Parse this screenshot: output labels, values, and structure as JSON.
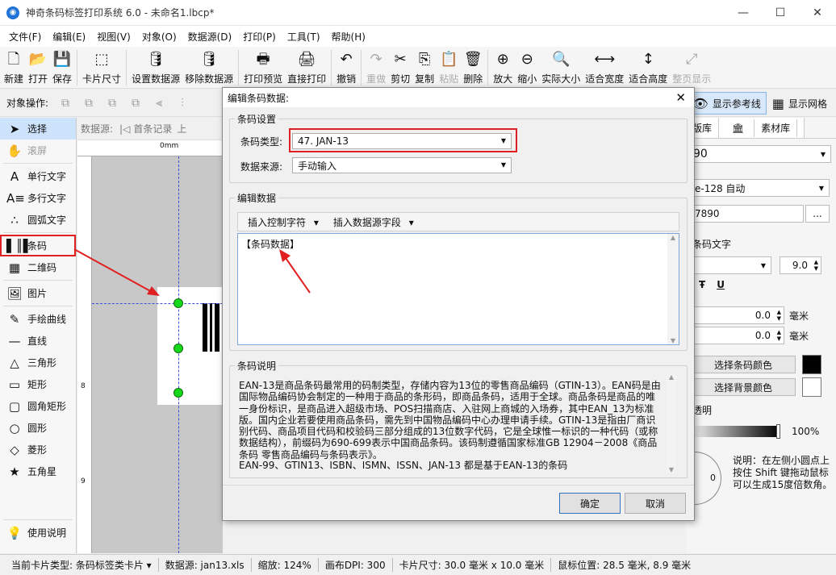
{
  "window": {
    "title": "神奇条码标签打印系统 6.0 - 未命名1.lbcp*",
    "min_icon": "minimize-icon",
    "max_icon": "maximize-icon",
    "close_icon": "close-icon"
  },
  "menu": [
    "文件(F)",
    "编辑(E)",
    "视图(V)",
    "对象(O)",
    "数据源(D)",
    "打印(P)",
    "工具(T)",
    "帮助(H)"
  ],
  "toolbar": [
    {
      "label": "新建",
      "icon": "new-file-icon",
      "glyph": "🗋"
    },
    {
      "label": "打开",
      "icon": "open-file-icon",
      "glyph": "📂"
    },
    {
      "label": "保存",
      "icon": "save-icon",
      "glyph": "💾"
    },
    {
      "label": "卡片尺寸",
      "icon": "card-size-icon",
      "glyph": "⬚"
    },
    {
      "label": "设置数据源",
      "icon": "set-datasource-icon",
      "glyph": "🛢"
    },
    {
      "label": "移除数据源",
      "icon": "remove-datasource-icon",
      "glyph": "🛢"
    },
    {
      "label": "打印预览",
      "icon": "print-preview-icon",
      "glyph": "🖶"
    },
    {
      "label": "直接打印",
      "icon": "print-icon",
      "glyph": "🖨"
    },
    {
      "label": "撤销",
      "icon": "undo-icon",
      "glyph": "↶"
    },
    {
      "label": "重做",
      "icon": "redo-icon",
      "glyph": "↷",
      "disabled": true
    },
    {
      "label": "剪切",
      "icon": "cut-icon",
      "glyph": "✂"
    },
    {
      "label": "复制",
      "icon": "copy-icon",
      "glyph": "⎘"
    },
    {
      "label": "粘贴",
      "icon": "paste-icon",
      "glyph": "📋",
      "disabled": true
    },
    {
      "label": "删除",
      "icon": "delete-icon",
      "glyph": "🗑"
    },
    {
      "label": "放大",
      "icon": "zoom-in-icon",
      "glyph": "⊕"
    },
    {
      "label": "缩小",
      "icon": "zoom-out-icon",
      "glyph": "⊖"
    },
    {
      "label": "实际大小",
      "icon": "actual-size-icon",
      "glyph": "🔍"
    },
    {
      "label": "适合宽度",
      "icon": "fit-width-icon",
      "glyph": "⟷"
    },
    {
      "label": "适合高度",
      "icon": "fit-height-icon",
      "glyph": "↕"
    },
    {
      "label": "整页显示",
      "icon": "full-page-icon",
      "glyph": "⤢",
      "disabled": true
    }
  ],
  "objbar": {
    "label": "对象操作:",
    "show_guides": "显示参考线",
    "show_grid": "显示网格"
  },
  "left_tools": [
    {
      "label": "选择",
      "icon": "pointer-icon",
      "glyph": "➤",
      "selected": true
    },
    {
      "label": "滚屏",
      "icon": "hand-icon",
      "glyph": "✋",
      "disabled": true
    },
    {
      "label": "单行文字",
      "icon": "single-text-icon",
      "glyph": "A"
    },
    {
      "label": "多行文字",
      "icon": "multi-text-icon",
      "glyph": "A≡"
    },
    {
      "label": "圆弧文字",
      "icon": "arc-text-icon",
      "glyph": "∴"
    },
    {
      "label": "条码",
      "icon": "barcode-icon",
      "glyph": "▌║▌"
    },
    {
      "label": "二维码",
      "icon": "qrcode-icon",
      "glyph": "▦"
    },
    {
      "label": "图片",
      "icon": "image-icon",
      "glyph": "🖼"
    },
    {
      "label": "手绘曲线",
      "icon": "pencil-icon",
      "glyph": "✎"
    },
    {
      "label": "直线",
      "icon": "line-icon",
      "glyph": "—"
    },
    {
      "label": "三角形",
      "icon": "triangle-icon",
      "glyph": "△"
    },
    {
      "label": "矩形",
      "icon": "rectangle-icon",
      "glyph": "▭"
    },
    {
      "label": "圆角矩形",
      "icon": "rounded-rect-icon",
      "glyph": "▢"
    },
    {
      "label": "圆形",
      "icon": "circle-icon",
      "glyph": "○"
    },
    {
      "label": "菱形",
      "icon": "diamond-icon",
      "glyph": "◇"
    },
    {
      "label": "五角星",
      "icon": "star-icon",
      "glyph": "★"
    },
    {
      "label": "使用说明",
      "icon": "help-bulb-icon",
      "glyph": "💡"
    }
  ],
  "nav": {
    "label": "数据源:",
    "first": "首条记录",
    "prev": "上"
  },
  "ruler": {
    "top_label": "0mm",
    "left_label_1": "8",
    "left_label_2": "9"
  },
  "right_panel": {
    "tab_1": "版库",
    "tab_2": "素材库",
    "value_1": "90",
    "value_2": "e-128 自动",
    "value_3": "7890",
    "more": "...",
    "section_text": "条码文字",
    "font_size": "9.0",
    "offset_1": "0.0",
    "offset_2": "0.0",
    "unit": "毫米",
    "choose_bar_color": "选择条码颜色",
    "choose_bg_color": "选择背景颜色",
    "transparency": "透明",
    "percent": "100%",
    "rotation_value": "0",
    "hint": "说明：在左侧小圆点上按住 Shift 键拖动鼠标可以生成15度倍数角。"
  },
  "status": {
    "card_type": "当前卡片类型: 条码标签类卡片",
    "datasource": "数据源: jan13.xls",
    "zoom": "缩放: 124%",
    "dpi": "画布DPI: 300",
    "card_size": "卡片尺寸: 30.0 毫米 x 10.0 毫米",
    "mouse_pos": "鼠标位置: 28.5 毫米, 8.9 毫米"
  },
  "dialog": {
    "title": "编辑条码数据:",
    "group_barcode_settings": "条码设置",
    "barcode_type_label": "条码类型:",
    "barcode_type_value": "47. JAN-13",
    "data_source_label": "数据来源:",
    "data_source_value": "手动输入",
    "group_edit_data": "编辑数据",
    "insert_control_char": "插入控制字符",
    "insert_datasource_field": "插入数据源字段",
    "edit_content": "【条码数据】",
    "group_description": "条码说明",
    "description": "EAN-13是商品条码最常用的码制类型，存储内容为13位的零售商品编码（GTIN-13）。EAN码是由国际物品编码协会制定的一种用于商品的条形码，即商品条码，适用于全球。商品条码是商品的唯一身份标识，是商品进入超级市场、POS扫描商店、入驻网上商城的入场券，其中EAN_13为标准版。国内企业若要使用商品条码，需先到中国物品编码中心办理申请手续。GTIN-13是指由厂商识别代码、商品项目代码和校验码三部分组成的13位数字代码，它是全球惟一标识的一种代码（或称数据结构），前缀码为690-699表示中国商品条码。该码制遵循国家标准GB 12904－2008《商品条码 零售商品编码与条码表示》。",
    "description_2": "EAN-99、GTIN13、ISBN、ISMN、ISSN、JAN-13 都是基于EAN-13的条码",
    "ok": "确定",
    "cancel": "取消"
  },
  "colors": {
    "accent": "#1e73d8",
    "highlight_red": "#e02020",
    "handle_green": "#16d81a",
    "guide_blue": "#3a52d8"
  }
}
